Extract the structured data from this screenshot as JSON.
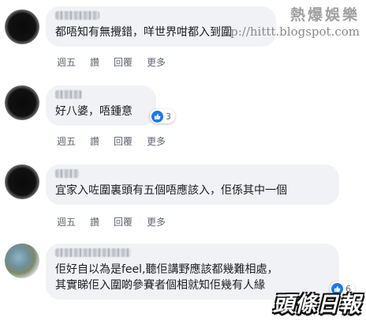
{
  "watermark": {
    "title": "熱爆娛樂",
    "url": "http://hittt.blogspot.com"
  },
  "logo": "頭條日報",
  "comments": [
    {
      "text": "都唔知有無攪錯，咩世界咁都入到圍",
      "actions": [
        "週五",
        "讚",
        "回覆",
        "更多"
      ]
    },
    {
      "text": "好八婆，唔鍾意",
      "reactions": "3",
      "actions": [
        "週五",
        "讚",
        "回覆",
        "更多"
      ]
    },
    {
      "text": "宜家入咗圍裏頭有五個唔應該入，佢係其中一個",
      "actions": [
        "週五",
        "讚",
        "回覆",
        "更多"
      ]
    },
    {
      "text_lines": [
        "佢好自以為是feel,聽佢講野應該都幾難相處，",
        "其實睇佢入圍啲參賽者個相就知佢幾有人緣"
      ],
      "reactions": "6",
      "actions": [
        "週五",
        "讚",
        "回覆",
        "更多"
      ]
    }
  ],
  "colors": {
    "bubble": "#f0f2f5",
    "like": "#1877f2",
    "action_text": "#606770"
  },
  "icons": {
    "like": "thumbs-up-icon"
  }
}
